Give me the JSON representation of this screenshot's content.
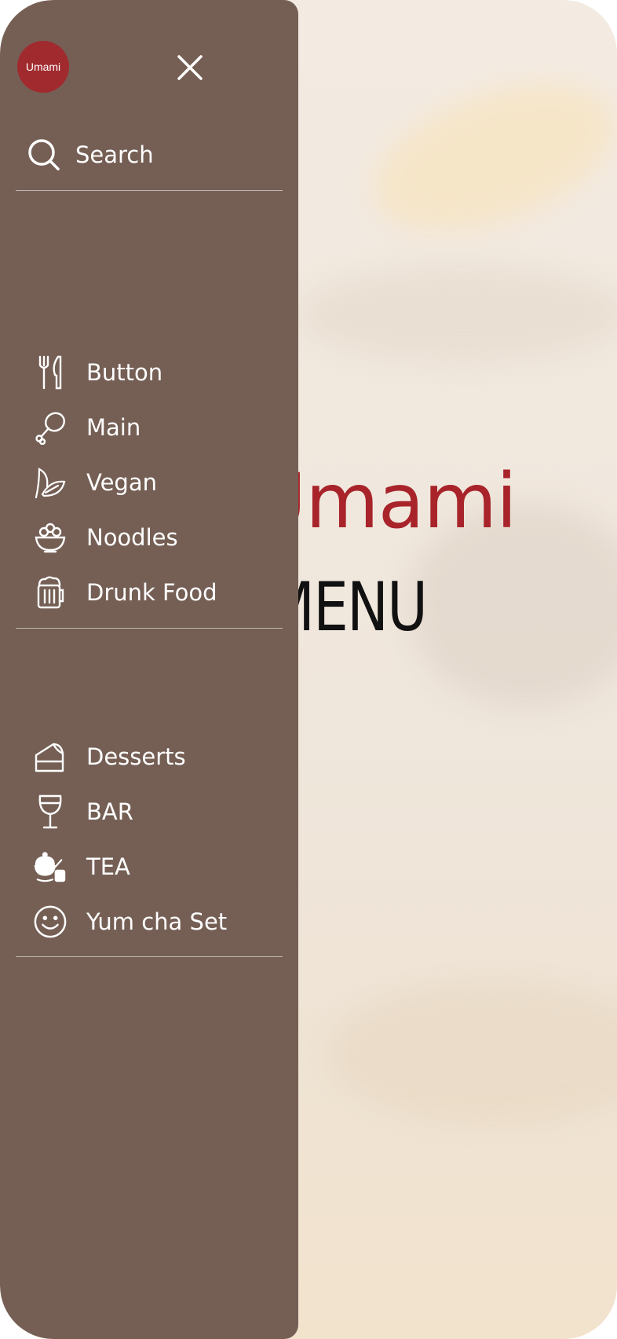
{
  "app": {
    "logo_text": "Umami"
  },
  "hero": {
    "brand": "Umami",
    "menu_title": "MENU"
  },
  "drawer": {
    "search_label": "Search",
    "group_main": [
      {
        "label": "Button",
        "icon": "cutlery-icon"
      },
      {
        "label": "Main",
        "icon": "drumstick-icon"
      },
      {
        "label": "Vegan",
        "icon": "leaf-icon"
      },
      {
        "label": "Noodles",
        "icon": "noodle-bowl-icon"
      },
      {
        "label": "Drunk Food",
        "icon": "beer-mug-icon"
      }
    ],
    "group_extra": [
      {
        "label": "Desserts",
        "icon": "cake-slice-icon"
      },
      {
        "label": "BAR",
        "icon": "wine-glass-icon"
      },
      {
        "label": "TEA",
        "icon": "teapot-icon"
      },
      {
        "label": "Yum cha Set",
        "icon": "smiley-icon"
      }
    ]
  },
  "colors": {
    "drawer": "#755f55",
    "brand_red": "#a8242a",
    "logo_red": "#a02a2e"
  }
}
